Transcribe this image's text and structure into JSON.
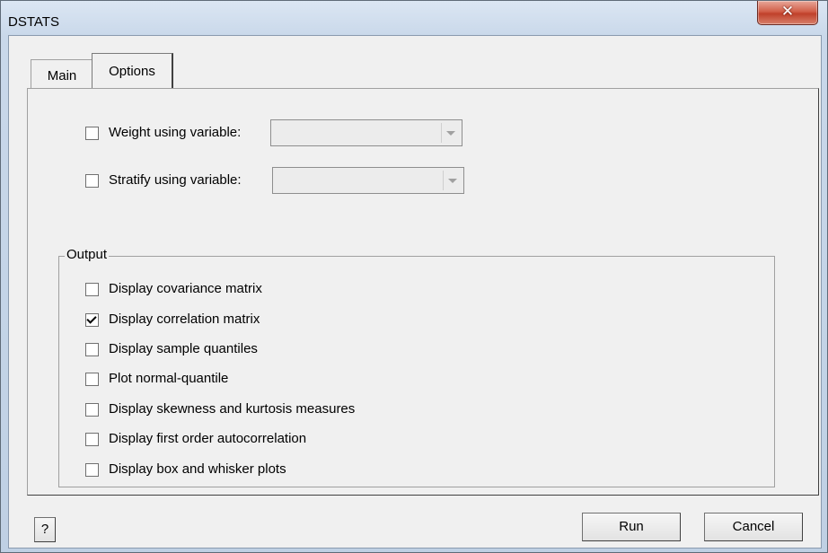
{
  "window": {
    "title": "DSTATS",
    "close_symbol": "✕"
  },
  "tabs": [
    {
      "label": "Main",
      "active": false
    },
    {
      "label": "Options",
      "active": true
    }
  ],
  "options": {
    "weight": {
      "label": "Weight using variable:",
      "checked": false,
      "value": ""
    },
    "stratify": {
      "label": "Stratify using variable:",
      "checked": false,
      "value": ""
    }
  },
  "output": {
    "title": "Output",
    "items": [
      {
        "label": "Display covariance matrix",
        "checked": false
      },
      {
        "label": "Display correlation matrix",
        "checked": true
      },
      {
        "label": "Display sample quantiles",
        "checked": false
      },
      {
        "label": "Plot normal-quantile",
        "checked": false
      },
      {
        "label": "Display skewness and kurtosis measures",
        "checked": false
      },
      {
        "label": "Display first order autocorrelation",
        "checked": false
      },
      {
        "label": "Display box and whisker plots",
        "checked": false
      }
    ]
  },
  "buttons": {
    "help": "?",
    "run": "Run",
    "cancel": "Cancel"
  }
}
